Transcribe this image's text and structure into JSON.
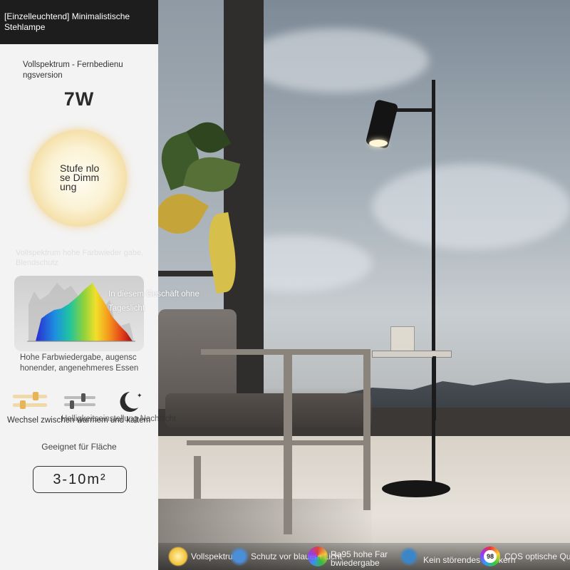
{
  "panel": {
    "title": "[Einzelleuchtend] Minimalistische Stehlampe",
    "subtitle": "Vollspektrum - Fernbedienu ngsversion",
    "wattage": "7W",
    "dimming_label": "Stufe nlose Dimm ung",
    "faded_caption": "Vollspektrum hohe Farbwieder gabe, Blendschutz",
    "overlay_caption": "In diesem Geschäft ohne Tageslicht",
    "color_caption": "Hohe Farbwiedergabe, augensc honender, angenehmeres Essen",
    "switch_caption": "Wechsel zwischen warmem und kaltem",
    "switch_caption_overlay": "Helligkeitseinstellung Nachtlicht",
    "area_label": "Geeignet für Fläche",
    "area_value": "3-10m²"
  },
  "features": [
    {
      "label": "Vollspektrum",
      "icon": "sun-icon"
    },
    {
      "label": "Schutz vor blauem Licht",
      "icon": "shield-eye-icon"
    },
    {
      "label": "Ra95 hohe Far bwiedergabe",
      "icon": "color-wheel-icon"
    },
    {
      "label": "Kein störendes Flackern",
      "icon": "wave-icon"
    },
    {
      "label": "COS optische Qu",
      "icon": "cos-badge-icon",
      "badge": "98"
    }
  ],
  "colors": {
    "title_bg": "#1d1d1d",
    "panel_bg": "#f3f3f3",
    "dim_glow": "#f3dca0"
  }
}
